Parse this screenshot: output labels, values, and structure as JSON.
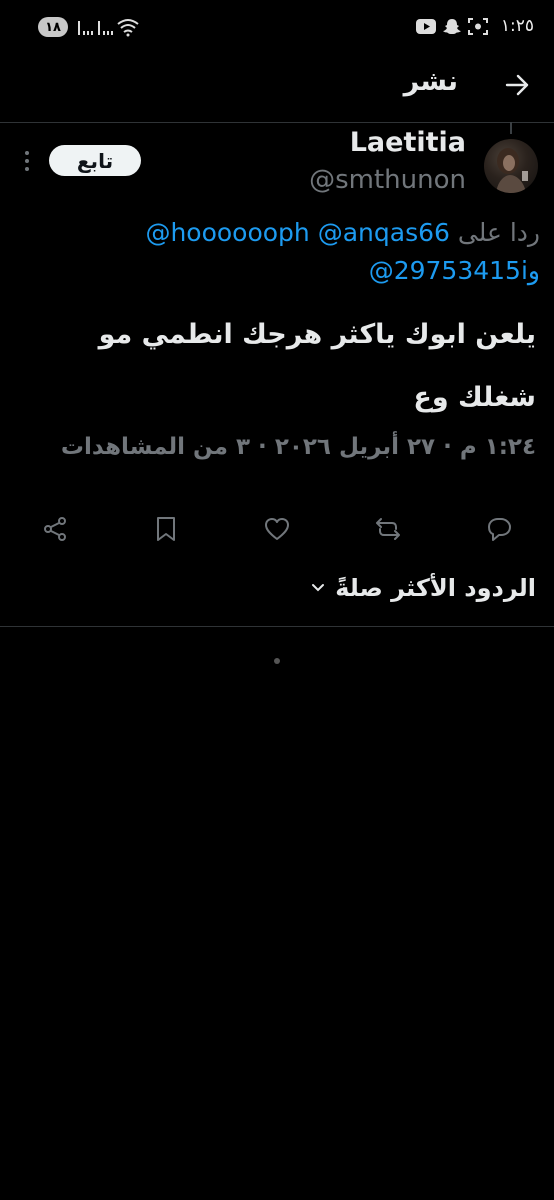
{
  "status_bar": {
    "time": "١:٢٥",
    "battery": "١٨"
  },
  "header": {
    "title": "نشر"
  },
  "tweet": {
    "name": "Laetitia",
    "handle": "@smthunon",
    "follow_label": "تابع",
    "reply_prefix": "ردا على",
    "reply_mentions_line1": "@hooooooph @anqas66",
    "reply_mentions_line2_prefix": "و",
    "reply_mentions_line2": "@29753415i",
    "text": "يلعن ابوك ياكثر هرجك انطمي مو شغلك وع",
    "timestamp": "١:٢٤ م · ٢٧ أبريل ٢٠٢٦ · ٣ من المشاهدات"
  },
  "replies": {
    "sort_label": "الردود الأكثر صلةً"
  },
  "colors": {
    "background": "#000000",
    "accent": "#1d9bf0",
    "muted": "#71767b",
    "divider": "#2f3336"
  }
}
